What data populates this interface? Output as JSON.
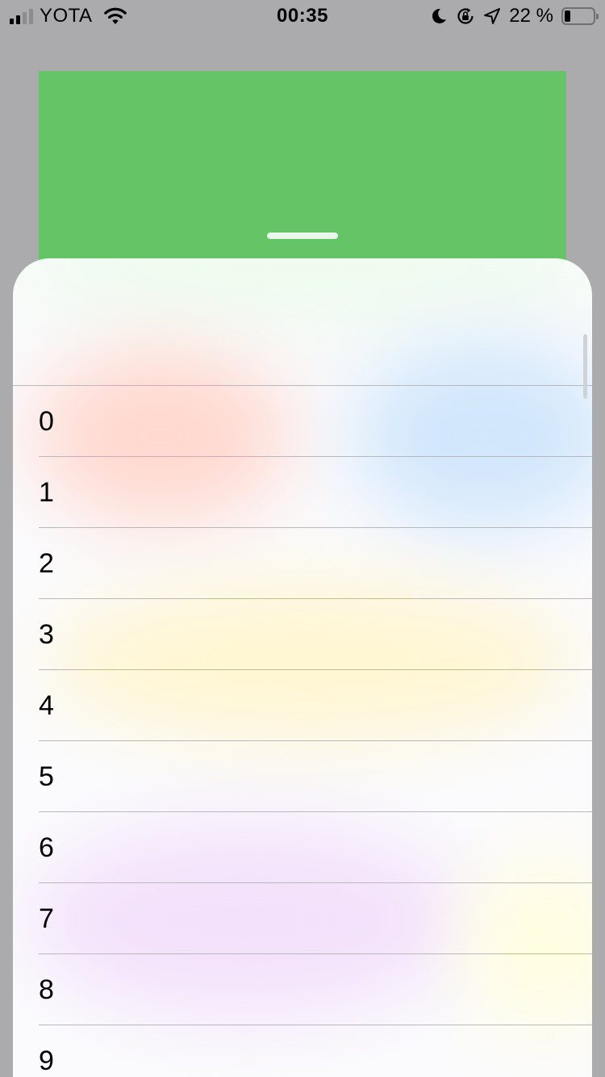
{
  "status_bar": {
    "carrier": "YOTA",
    "time": "00:35",
    "battery_percent": "22 %",
    "battery_level": 0.22,
    "signal_bars_active": 2,
    "signal_bars_total": 4,
    "icons": [
      "signal-icon",
      "wifi-icon",
      "moon-icon",
      "orientation-lock-icon",
      "location-arrow-icon",
      "battery-icon"
    ]
  },
  "background_card": {
    "color": "#64c466"
  },
  "sheet": {
    "rows": [
      {
        "label": "0"
      },
      {
        "label": "1"
      },
      {
        "label": "2"
      },
      {
        "label": "3"
      },
      {
        "label": "4"
      },
      {
        "label": "5"
      },
      {
        "label": "6"
      },
      {
        "label": "7"
      },
      {
        "label": "8"
      },
      {
        "label": "9"
      }
    ]
  }
}
